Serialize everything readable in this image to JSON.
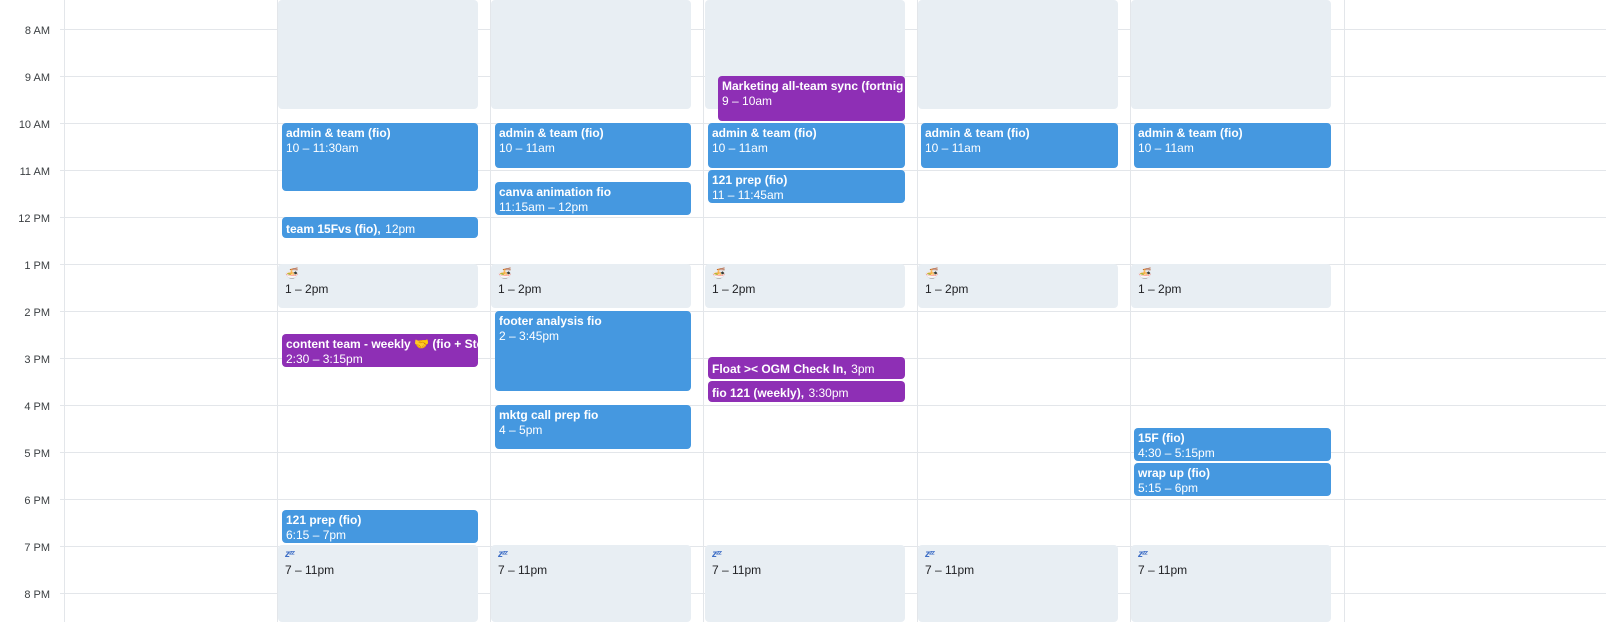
{
  "time_labels": [
    "8 AM",
    "9 AM",
    "10 AM",
    "11 AM",
    "12 PM",
    "1 PM",
    "2 PM",
    "3 PM",
    "4 PM",
    "5 PM",
    "6 PM",
    "7 PM",
    "8 PM"
  ],
  "colors": {
    "event_blue": "#4598e0",
    "event_purple": "#8e2fb5",
    "blocked_time": "#e8eef3",
    "gridline": "#e3e6ea"
  },
  "days": [
    {
      "blocks": [
        {
          "time": "1 – 2pm",
          "icon": "bowl-emoji-icon",
          "glyph": "🍜"
        },
        {
          "time": "7 – 11pm",
          "icon": "zzz-emoji-icon",
          "glyph": "zᶻᶻ"
        }
      ],
      "events": [
        {
          "title": "admin & team (fio)",
          "time": "10 – 11:30am"
        },
        {
          "title": "team 15Fvs (fio),",
          "time": "12pm"
        },
        {
          "title": "content team - weekly 🤝 (fio + Ste",
          "time": "2:30 – 3:15pm"
        },
        {
          "title": "121 prep (fio)",
          "time": "6:15 – 7pm"
        }
      ]
    },
    {
      "blocks": [
        {
          "time": "1 – 2pm",
          "icon": "bowl-emoji-icon",
          "glyph": "🍜"
        },
        {
          "time": "7 – 11pm",
          "icon": "zzz-emoji-icon",
          "glyph": "zᶻᶻ"
        }
      ],
      "events": [
        {
          "title": "admin & team (fio)",
          "time": "10 – 11am"
        },
        {
          "title": "canva animation fio",
          "time": "11:15am – 12pm"
        },
        {
          "title": "footer analysis fio",
          "time": "2 – 3:45pm"
        },
        {
          "title": "mktg call prep fio",
          "time": "4 – 5pm"
        }
      ]
    },
    {
      "blocks": [
        {
          "time": "1 – 2pm",
          "icon": "bowl-emoji-icon",
          "glyph": "🍜"
        },
        {
          "time": "7 – 11pm",
          "icon": "zzz-emoji-icon",
          "glyph": "zᶻᶻ"
        }
      ],
      "events": [
        {
          "title": "Marketing all-team sync (fortnig",
          "time": "9 – 10am"
        },
        {
          "title": "admin & team (fio)",
          "time": "10 – 11am"
        },
        {
          "title": "121 prep (fio)",
          "time": "11 – 11:45am"
        },
        {
          "title": "Float >< OGM Check In,",
          "time": "3pm"
        },
        {
          "title": "fio 121 (weekly),",
          "time": "3:30pm"
        }
      ]
    },
    {
      "blocks": [
        {
          "time": "1 – 2pm",
          "icon": "bowl-emoji-icon",
          "glyph": "🍜"
        },
        {
          "time": "7 – 11pm",
          "icon": "zzz-emoji-icon",
          "glyph": "zᶻᶻ"
        }
      ],
      "events": [
        {
          "title": "admin & team (fio)",
          "time": "10 – 11am"
        }
      ]
    },
    {
      "blocks": [
        {
          "time": "1 – 2pm",
          "icon": "bowl-emoji-icon",
          "glyph": "🍜"
        },
        {
          "time": "7 – 11pm",
          "icon": "zzz-emoji-icon",
          "glyph": "zᶻᶻ"
        }
      ],
      "events": [
        {
          "title": "admin & team (fio)",
          "time": "10 – 11am"
        },
        {
          "title": "15F (fio)",
          "time": "4:30 – 5:15pm"
        },
        {
          "title": "wrap up (fio)",
          "time": "5:15 – 6pm"
        }
      ]
    }
  ]
}
